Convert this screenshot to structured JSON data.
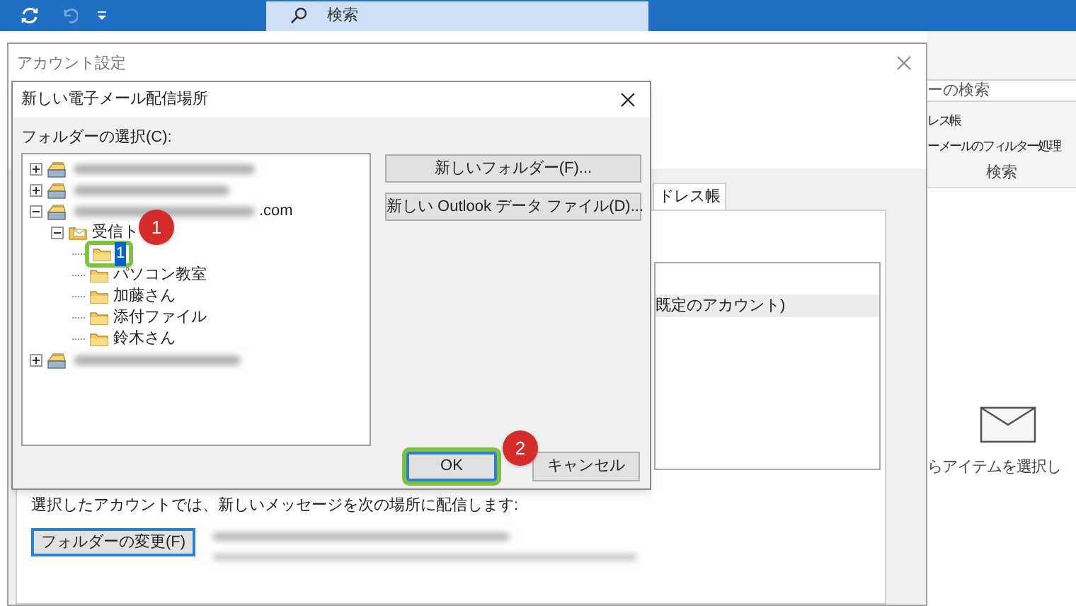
{
  "toolbar": {
    "search_placeholder": "検索"
  },
  "account_settings": {
    "title": "アカウント設定",
    "tab_label": "ドレス帳",
    "list_row": "既定のアカウント)",
    "deliver_note": "選択したアカウントでは、新しいメッセージを次の場所に配信します:",
    "change_folder_button": "フォルダーの変更(F)"
  },
  "ribbon": {
    "search_field": "ーの検索",
    "items": [
      "レス帳",
      "ーメールのフィルター処理"
    ],
    "group_label": "検索"
  },
  "reading_pane": {
    "message": "らアイテムを選択し"
  },
  "dialog": {
    "title": "新しい電子メール配信場所",
    "folder_label": "フォルダーの選択(C):",
    "tree": [
      {
        "kind": "account",
        "redacted": true,
        "expanded": false,
        "selected": false
      },
      {
        "kind": "account",
        "redacted": true,
        "expanded": false,
        "selected": false
      },
      {
        "kind": "account",
        "redacted": true,
        "label": ".com",
        "expanded": true,
        "selected": false,
        "children": [
          {
            "kind": "inbox",
            "label": "受信ト",
            "expanded": true,
            "selected": false,
            "children": [
              {
                "kind": "folder",
                "label": "1",
                "selected": true,
                "highlighted": true
              },
              {
                "kind": "folder",
                "label": "パソコン教室",
                "selected": false,
                "highlighted": false
              },
              {
                "kind": "folder",
                "label": "加藤さん",
                "selected": false,
                "highlighted": false
              },
              {
                "kind": "folder",
                "label": "添付ファイル",
                "selected": false,
                "highlighted": false
              },
              {
                "kind": "folder",
                "label": "鈴木さん",
                "selected": false,
                "highlighted": false
              }
            ]
          }
        ]
      },
      {
        "kind": "account",
        "redacted": true,
        "expanded": false,
        "selected": false
      }
    ],
    "side_buttons": [
      "新しいフォルダー(F)...",
      "新しい Outlook データ ファイル(D)..."
    ],
    "ok_button": {
      "label": "OK",
      "highlighted": true
    },
    "cancel_button": {
      "label": "キャンセル"
    }
  },
  "callouts": [
    {
      "number": "1"
    },
    {
      "number": "2"
    }
  ]
}
